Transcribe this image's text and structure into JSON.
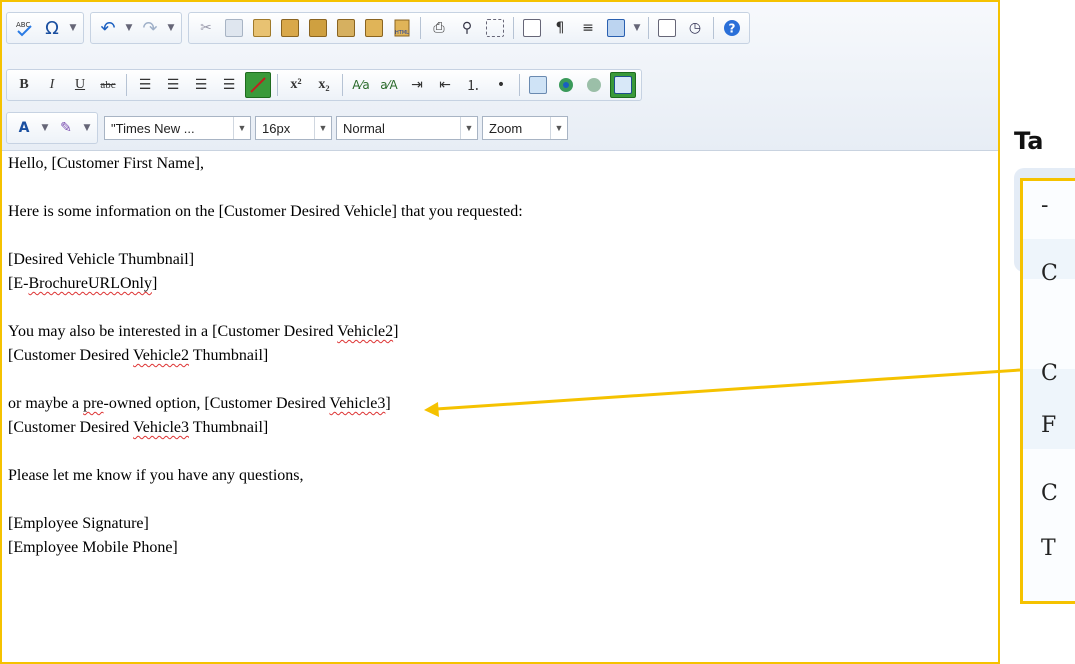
{
  "toolbar": {
    "row1": [
      "spellcheck-icon",
      "omega-icon",
      "undo-icon",
      "redo-icon",
      "cut-icon",
      "copy-icon",
      "paste-icon",
      "paste-text-icon",
      "paste-word-icon",
      "paste-html-icon",
      "print-icon",
      "find-icon",
      "select-all-icon",
      "template-icon",
      "paragraph-icon",
      "justify-icon",
      "insert-table-icon",
      "form-icon",
      "clock-icon",
      "help-icon"
    ],
    "row2": [
      "bold-icon",
      "italic-icon",
      "underline-icon",
      "strikethrough-icon",
      "align-left-icon",
      "align-center-icon",
      "align-right-icon",
      "align-justify-icon",
      "remove-format-icon",
      "superscript-icon",
      "subscript-icon",
      "convert-lower-icon",
      "convert-upper-icon",
      "indent-icon",
      "outdent-icon",
      "numbered-list-icon",
      "bulleted-list-icon",
      "image-icon",
      "link-icon",
      "unlink-icon",
      "save-icon"
    ],
    "bold_label": "B",
    "italic_label": "I",
    "underline_label": "U",
    "strike_label": "abc",
    "font_family": "\"Times New ...",
    "font_size": "16px",
    "paragraph_style": "Normal",
    "zoom": "Zoom",
    "accent_color": "#f5c200"
  },
  "content": {
    "greeting": "Hello, [Customer First Name],",
    "intro": "Here is some information on the [Customer Desired Vehicle] that you requested:",
    "thumb1": "[Desired Vehicle Thumbnail]",
    "brochure_prefix": "[E-",
    "brochure_word": "BrochureURLOnly",
    "brochure_suffix": "]",
    "also_prefix": "You may also be interested in a [Customer Desired ",
    "also_word": "Vehicle2",
    "also_suffix": "]",
    "thumb2_prefix": "[Customer Desired ",
    "thumb2_word": "Vehicle2",
    "thumb2_suffix": " Thumbnail]",
    "or_prefix": "or maybe a ",
    "or_word": "pre",
    "or_mid": "-owned option, [Customer Desired ",
    "or_word2": "Vehicle3",
    "or_suffix": "]",
    "thumb3_prefix": "[Customer Desired ",
    "thumb3_word": "Vehicle3",
    "thumb3_suffix": " Thumbnail]",
    "closing": "Please let me know if you have any questions,",
    "signature": "[Employee Signature]",
    "phone": "[Employee Mobile Phone]"
  },
  "side_panel": {
    "title": "Ta",
    "cells": [
      "-",
      "C",
      "C",
      "F",
      "C",
      "T"
    ]
  }
}
